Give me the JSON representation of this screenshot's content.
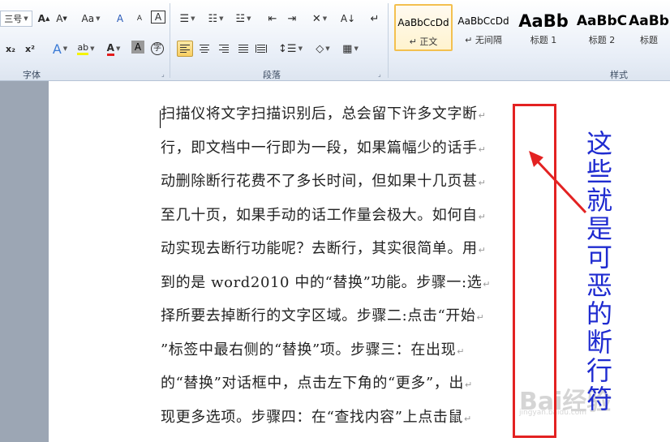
{
  "ribbon": {
    "font_group": {
      "label": "字体",
      "font_size": "三号",
      "grow": "A",
      "shrink": "A",
      "case": "Aa",
      "clear": "A",
      "phonetic": "A",
      "border_char": "A",
      "subscript": "x₂",
      "superscript": "x²",
      "effects": "A",
      "highlight": "ab",
      "font_color": "A",
      "shading": "A",
      "enclose": "字"
    },
    "paragraph_group": {
      "label": "段落"
    },
    "styles_group": {
      "label": "样式",
      "items": [
        {
          "sample": "AaBbCcDd",
          "name": "↵ 正文"
        },
        {
          "sample": "AaBbCcDd",
          "name": "↵ 无间隔"
        },
        {
          "sample": "AaBb",
          "name": "标题 1"
        },
        {
          "sample": "AaBbC",
          "name": "标题 2"
        },
        {
          "sample": "AaBb",
          "name": "标题"
        }
      ]
    }
  },
  "document": {
    "lines": [
      "扫描仪将文字扫描识别后，总会留下许多文字断",
      "行，即文档中一行即为一段，如果篇幅少的话手",
      "动删除断行花费不了多长时间，但如果十几页甚",
      "至几十页，如果手动的话工作量会极大。如何自",
      "动实现去断行功能呢？去断行，其实很简单。用",
      "到的是 word2010 中的“替换”功能。步骤一:选",
      "择所要去掉断行的文字区域。步骤二:点击“开始",
      "”标签中最右侧的“替换”项。步骤三：在出现",
      "的“替换”对话框中，点击左下角的“更多”，出",
      "现更多选项。步骤四：在“查找内容”上点击鼠"
    ],
    "break_mark": "↵"
  },
  "annotation": {
    "chars": [
      "这",
      "些",
      "就",
      "是",
      "可",
      "恶",
      "的",
      "断",
      "行",
      "符"
    ],
    "color": "#1f2bd0",
    "box_color": "#e32222"
  },
  "watermark": {
    "text": "Bai经验",
    "sub": "jingyan.baidu.com"
  }
}
